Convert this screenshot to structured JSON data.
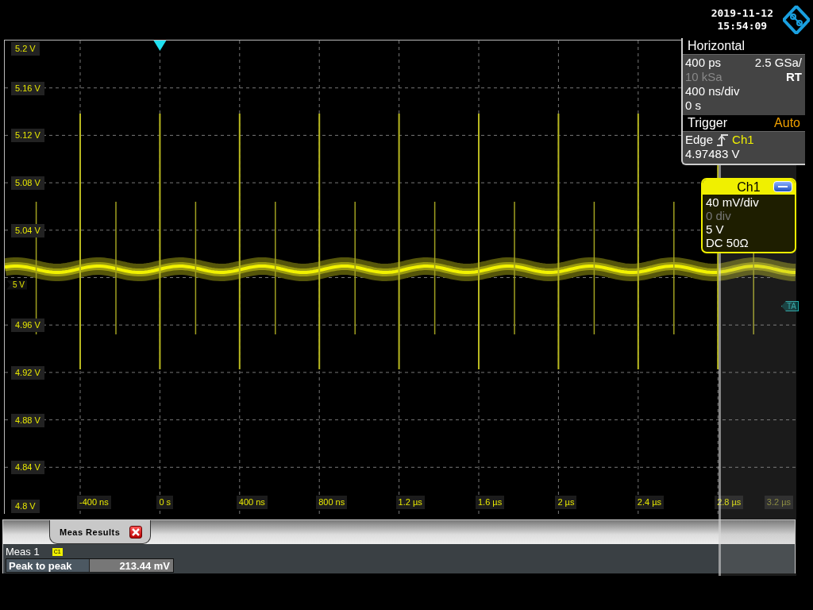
{
  "timestamp": {
    "date": "2019-11-12",
    "time": "15:54:09"
  },
  "plot": {
    "y_labels": [
      {
        "kind": "label",
        "text": "5.2 V"
      },
      {
        "kind": "label",
        "text": "5.16 V"
      },
      {
        "kind": "label",
        "text": "5.12 V"
      },
      {
        "kind": "label",
        "text": "5.08 V"
      },
      {
        "kind": "label",
        "text": "5.04 V"
      },
      {
        "kind": "offset_marker",
        "text": "5 V"
      },
      {
        "kind": "label",
        "text": "4.96 V"
      },
      {
        "kind": "label",
        "text": "4.92 V"
      },
      {
        "kind": "label",
        "text": "4.88 V"
      },
      {
        "kind": "label",
        "text": "4.84 V"
      },
      {
        "kind": "label",
        "text": "4.8 V"
      }
    ],
    "x_labels": [
      "-400 ns",
      "0 s",
      "400 ns",
      "800 ns",
      "1.2 µs",
      "1.6 µs",
      "2 µs",
      "2.4 µs",
      "2.8 µs",
      "3.2 µs"
    ],
    "trigger_marker": "TA"
  },
  "horizontal": {
    "title": "Horizontal",
    "resolution": "400 ps",
    "sample_rate": "2.5 GSa/",
    "record_length": "10 kSa",
    "acquisition_mode": "RT",
    "time_scale": "400 ns/div",
    "position": "0 s"
  },
  "trigger": {
    "title": "Trigger",
    "mode": "Auto",
    "type": "Edge",
    "source": "Ch1",
    "level": "4.97483 V"
  },
  "channel": {
    "name": "Ch1",
    "scale": "40 mV/div",
    "offset": "0 div",
    "position": "5 V",
    "coupling": "DC 50Ω"
  },
  "meas_results": {
    "tab": "Meas Results",
    "title": "Meas 1",
    "source_badge": "C1",
    "rows": [
      {
        "label": "Peak to peak",
        "value": "213.44 mV"
      }
    ]
  }
}
